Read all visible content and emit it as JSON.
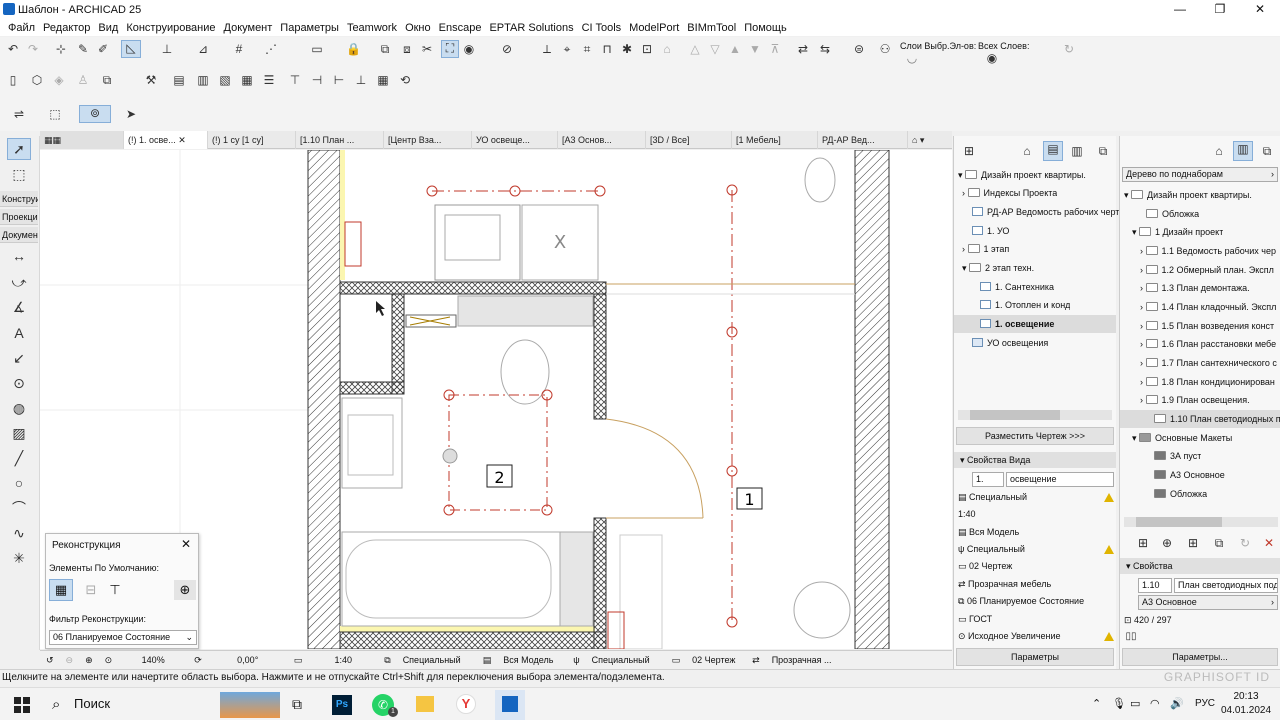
{
  "window": {
    "title": "Шаблон - ARCHICAD 25",
    "min": "—",
    "max": "❐",
    "close": "✕"
  },
  "menu": [
    "Файл",
    "Редактор",
    "Вид",
    "Конструирование",
    "Документ",
    "Параметры",
    "Teamwork",
    "Окно",
    "Enscape",
    "EPTAR Solutions",
    "CI Tools",
    "ModelPort",
    "BIMmTool",
    "Помощь"
  ],
  "toolbar": {
    "layers_label": "Слои Выбр.Эл-ов:",
    "all_layers_label": "Всех Слоев:"
  },
  "left_palette": {
    "labels": [
      "Конструи",
      "Проекци",
      "Докумен"
    ]
  },
  "tabs": [
    "(!) 1. осве...",
    "(!) 1 су [1 су]",
    "[1.10 План ...",
    "[Центр Вза...",
    "УО освеще...",
    "[А3 Основ...",
    "[3D / Все]",
    "[1 Мебель]",
    "РД-АР Вед..."
  ],
  "plan": {
    "room1": "1",
    "room2": "2",
    "x_mark": "X"
  },
  "reconstruction": {
    "title": "Реконструкция",
    "default_label": "Элементы По Умолчанию:",
    "filter_label": "Фильтр Реконструкции:",
    "filter_value": "06 Планируемое Состояние"
  },
  "bottom": {
    "zoom": "140%",
    "angle": "0,00°",
    "scale": "1:40",
    "layers": "Специальный",
    "model": "Вся Модель",
    "pen": "Специальный",
    "drawing": "02 Чертеж",
    "more": "Прозрачная ..."
  },
  "status": "Щелкните на элементе или начертите область выбора. Нажмите и не отпускайте Ctrl+Shift для переключения выбора элемента/подэлемента.",
  "watermark": "GRAPHISOFT ID",
  "navigator": {
    "root": "Дизайн проект квартиры.",
    "items": [
      "Индексы Проекта",
      "РД-АР Ведомость рабочих черте",
      "1. УО",
      "1 этап",
      "2 этап техн.",
      "1. Сантехника",
      "1. Отоплен и конд",
      "1. освещение",
      "УО освещения"
    ],
    "place_button": "Разместить Чертеж >>>",
    "view_props_title": "Свойства Вида",
    "view_id": "1.",
    "view_name": "освещение",
    "props": [
      "Специальный",
      "1:40",
      "Вся Модель",
      "Специальный",
      "02 Чертеж",
      "Прозрачная мебель",
      "06 Планируемое Состояние",
      "ГОСТ",
      "Исходное Увеличение"
    ],
    "params_button": "Параметры"
  },
  "layout_book": {
    "dropdown": "Дерево по поднаборам",
    "root": "Дизайн проект квартиры.",
    "items": [
      "Обложка",
      "1 Дизайн проект",
      "1.1 Ведомость рабочих чер",
      "1.2 Обмерный план. Экспл",
      "1.3 План демонтажа.",
      "1.4 План кладочный. Экспл",
      "1.5 План возведения конст",
      "1.6 План расстановки мебе",
      "1.7 План сантехнического с",
      "1.8 План кондиционирован",
      "1.9 План освещения.",
      "1.10 План светодиодных по",
      "Основные Макеты",
      "3А пуст",
      "А3 Основное",
      "Обложка"
    ],
    "props_title": "Свойства",
    "layout_id": "1.10",
    "layout_name": "План светодиодных подс",
    "master": "А3 Основное",
    "size": "420 / 297",
    "params_button": "Параметры..."
  },
  "taskbar": {
    "search": "Поиск",
    "time": "20:13",
    "date": "04.01.2024",
    "lang": "РУС",
    "badge": "1"
  }
}
